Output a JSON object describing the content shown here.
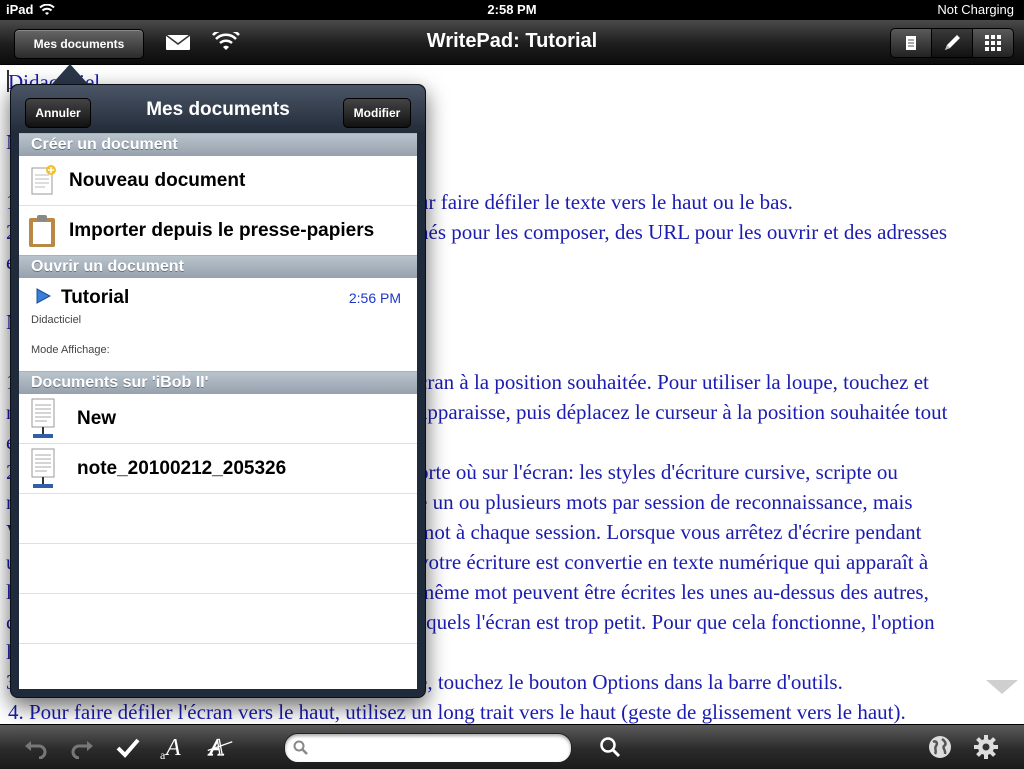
{
  "status_bar": {
    "device": "iPad",
    "time": "2:58 PM",
    "battery": "Not Charging"
  },
  "navbar": {
    "docs_button": "Mes documents",
    "title": "WritePad: Tutorial",
    "icons": [
      "mail-icon",
      "wifi-icon",
      "document-icon",
      "pen-icon",
      "keyboard-icon"
    ]
  },
  "document": {
    "lines": [
      "Didacticiel",
      "ur faire défiler le texte vers le haut ou le bas.",
      "nés pour les composer, des URL pour les ouvrir et des adresses",
      "cran à la position souhaitée. Pour utiliser la loupe, touchez et",
      "apparaisse, puis déplacez le curseur à la position souhaitée tout",
      "orte où sur l'écran: les styles d'écriture cursive, scripte ou",
      "e un ou plusieurs mots par session de reconnaissance, mais",
      "mot à chaque session. Lorsque vous arrêtez d'écrire pendant",
      " votre écriture est convertie en texte numérique qui apparaît à",
      " même mot peuvent être écrites les unes au-dessus des autres,",
      "squels l'écran est trop petit. Pour que cela fonctionne, l'option",
      "e, touchez le bouton Options dans la barre d'outils.",
      "4. Pour faire défiler l'écran vers le haut, utilisez un long trait vers le haut (geste de glissement vers le haut)."
    ],
    "edge_fragments": [
      "N",
      "1",
      "2",
      "e",
      "N",
      "1",
      "n",
      "e",
      "2",
      "n",
      "V",
      "u",
      "l",
      "c",
      "l",
      "3"
    ]
  },
  "popover": {
    "title": "Mes documents",
    "cancel": "Annuler",
    "edit": "Modifier",
    "section_create": "Créer un document",
    "new_document": "Nouveau document",
    "import_clipboard": "Importer depuis le presse-papiers",
    "section_open": "Ouvrir un document",
    "open_doc": {
      "name": "Tutorial",
      "time": "2:56 PM",
      "subtitle": "Didacticiel",
      "mode_label": "Mode Affichage:"
    },
    "section_remote": "Documents sur 'iBob II'",
    "remote_docs": [
      "New",
      "note_20100212_205326"
    ]
  },
  "toolbar": {
    "search_placeholder": "",
    "icons": [
      "undo-icon",
      "redo-icon",
      "checkmark-icon",
      "font-icon",
      "recognition-icon",
      "search-icon",
      "globe-icon",
      "settings-icon"
    ]
  }
}
